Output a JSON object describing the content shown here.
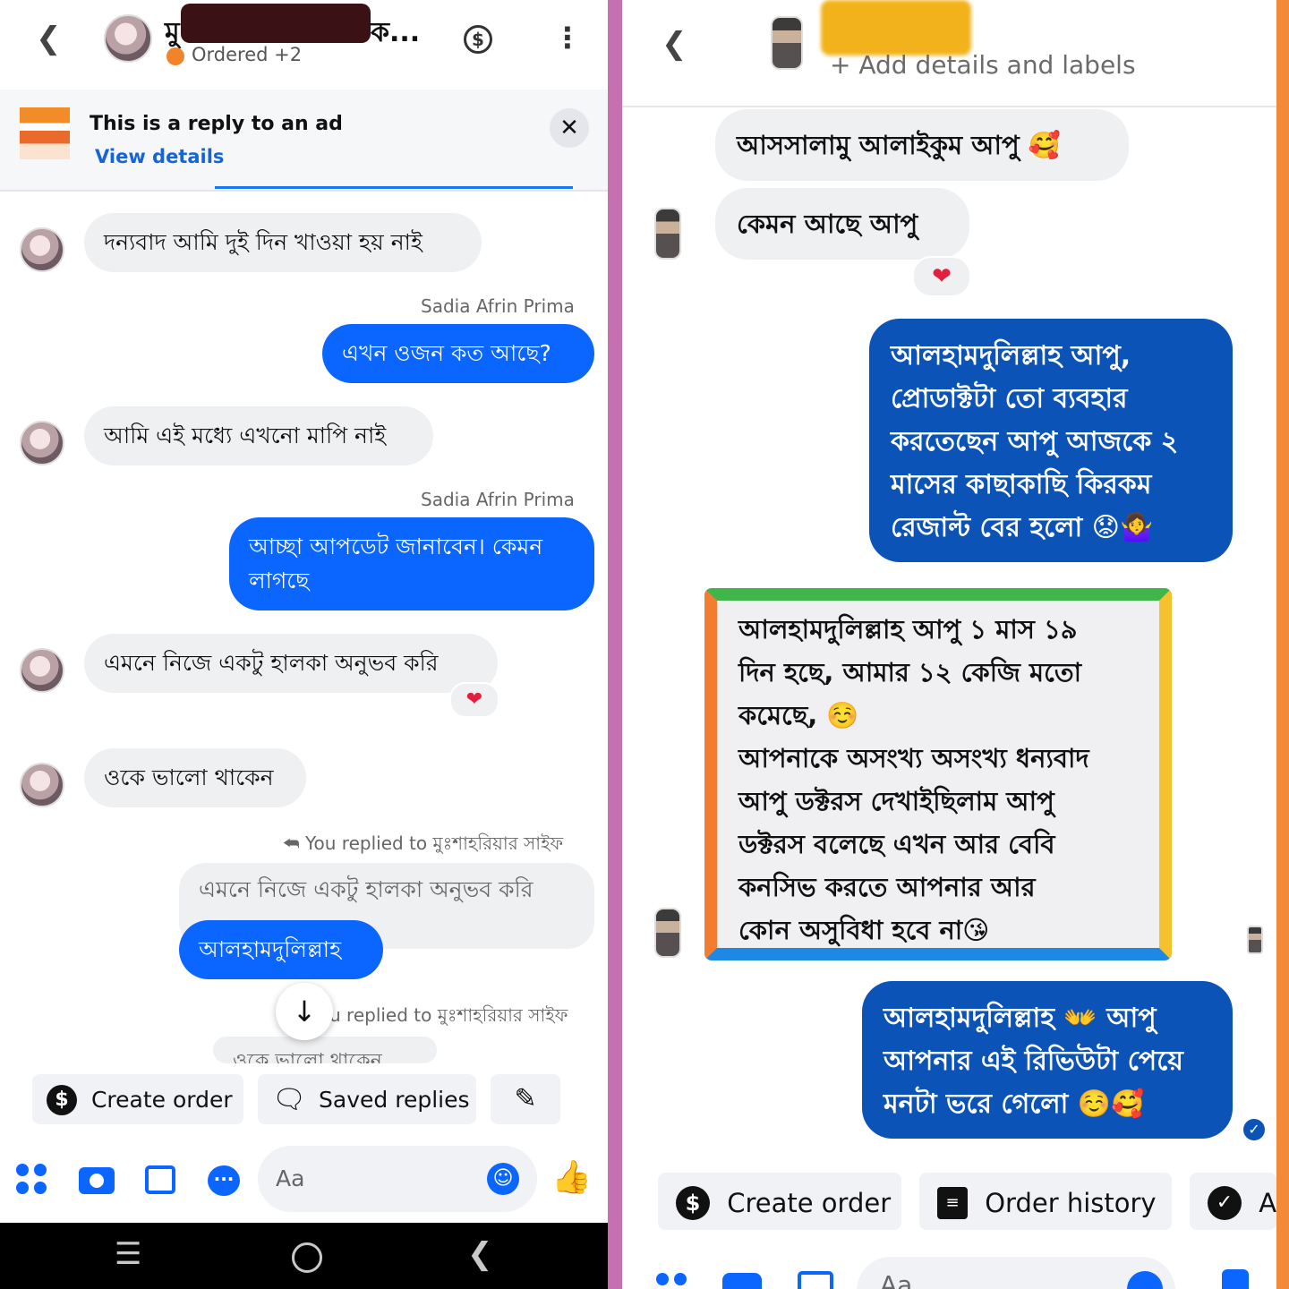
{
  "left": {
    "header": {
      "contact_name": "মু",
      "contact_name_tail": "ক...",
      "status": "Ordered +2"
    },
    "ad_banner": {
      "title": "This is a reply to an ad",
      "link": "View details",
      "close": "✕"
    },
    "messages": [
      {
        "text": "দন্যবাদ আমি দুই দিন খাওয়া হয় নাই"
      },
      {
        "sender": "Sadia Afrin Prima",
        "text": "এখন ওজন কত আছে?"
      },
      {
        "text": "আমি এই মধ্যে এখনো মাপি নাই"
      },
      {
        "sender": "Sadia Afrin Prima",
        "text_line1": "আচ্ছা আপডেট জানাবেন। কেমন",
        "text_line2": "লাগছে"
      },
      {
        "text": "এমনে নিজে একটু হালকা অনুভব করি",
        "reaction": "❤"
      },
      {
        "text": "ওকে ভালো থাকেন"
      }
    ],
    "reply_block": {
      "replied_label": "You replied to মুঃশাহরিয়ার সাইফ",
      "quoted": "এমনে নিজে একটু হালকা অনুভব করি",
      "reply": "আলহামদুলিল্লাহ",
      "replied_label_2": "u replied to মুঃশাহরিয়ার সাইফ",
      "quoted_2": "ওকে ভালো থাকেন"
    },
    "chips": {
      "create_order": "Create order",
      "saved_replies": "Saved replies"
    },
    "composer": {
      "placeholder": "Aa"
    }
  },
  "right": {
    "header": {
      "add_details": "+ Add details and labels"
    },
    "messages": {
      "greeting": "আসসালামু আলাইকুম আপু 🥰",
      "how_are_you": "কেমন আছে আপু",
      "reaction": "❤",
      "out1": "আলহামদুলিল্লাহ আপু, প্রোডাক্টটা তো ব্যবহার করতেছেন আপু আজকে ২ মাসের কাছাকাছি কিরকম রেজাল্ট বের হলো 😟🤷‍♀️",
      "framed": "আলহামদুলিল্লাহ আপু ১ মাস ১৯\nদিন হছে,  আমার ১২ কেজি মতো\nকমেছে, ☺️\nআপনাকে অসংখ্য অসংখ্য ধন্যবাদ\nআপু ডক্টরস দেখাইছিলাম আপু\nডক্টরস বলেছে এখন আর বেবি\nকনসিভ করতে আপনার আর\nকোন অসুবিধা হবে না😘",
      "out2": "আলহামদুলিল্লাহ 👐 আপু আপনার এই রিভিউটা পেয়ে মনটা ভরে গেলো ☺️🥰"
    },
    "chips": {
      "create_order": "Create order",
      "order_history": "Order history",
      "third": "A"
    },
    "composer": {
      "placeholder": "Aa"
    }
  },
  "colors": {
    "messenger_blue": "#0a66ff",
    "dark_blue": "#0b53b6",
    "divider": "#c770b0",
    "edge": "#f28a3a"
  }
}
